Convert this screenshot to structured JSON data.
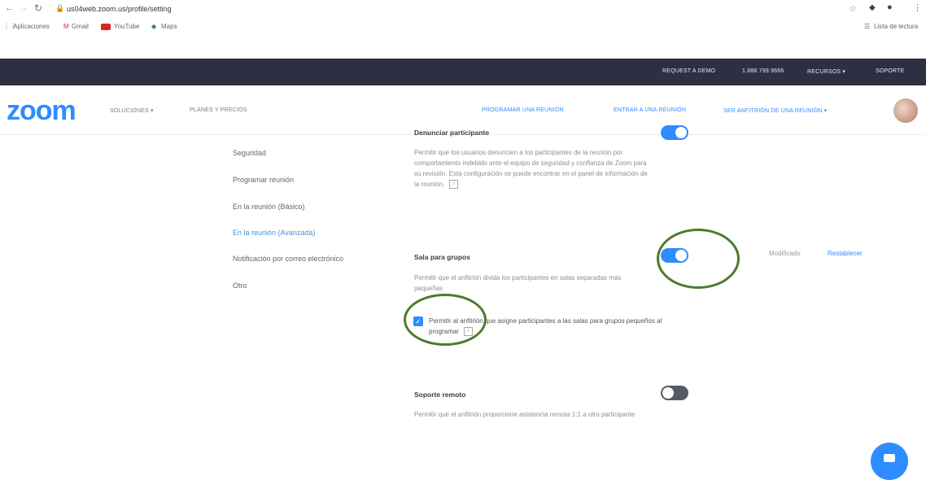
{
  "browser": {
    "url": "us04web.zoom.us/profile/setting",
    "bookmarks": [
      "Aplicaciones",
      "Gmail",
      "YouTube",
      "Maps"
    ],
    "reading_list": "Lista de lectura"
  },
  "topbar": {
    "items": [
      "REQUEST A DEMO",
      "1.888.799.9666",
      "RECURSOS ▾",
      "SOPORTE"
    ]
  },
  "header": {
    "logo": "zoom",
    "left_links": [
      "SOLUCIONES ▾",
      "PLANES Y PRECIOS"
    ],
    "right_links": [
      "PROGRAMAR UNA REUNIÓN",
      "ENTRAR A UNA REUNIÓN",
      "SER ANFITRIÓN DE UNA REUNIÓN ▾"
    ]
  },
  "nav": {
    "items": [
      "Seguridad",
      "Programar reunión",
      "En la reunión (Básico)",
      "En la reunión (Avanzada)",
      "Notificación por correo electrónico",
      "Otro"
    ],
    "active_index": 3
  },
  "settings": {
    "report": {
      "title": "Denunciar participante",
      "description": "Permitir que los usuarios denuncien a los participantes de la reunión por comportamiento indebido ante el equipo de seguridad y confianza de Zoom para su revisión. Esta configuración se puede encontrar en el panel de información de la reunión."
    },
    "breakout": {
      "title": "Sala para grupos",
      "description": "Permitir que el anfitrión divida los participantes en salas separadas más pequeñas",
      "checkbox_label": "Permitir al anfitrión que asigne participantes a las salas para grupos pequeños al programar",
      "modified": "Modificado",
      "reset": "Restablecer",
      "enabled": true
    },
    "remote": {
      "title": "Soporte remoto",
      "description": "Permitir que el anfitrión proporcione asistencia remota 1:1 a otro participante",
      "enabled": false
    }
  },
  "colors": {
    "accent": "#2D8CFF",
    "topbar": "#2d2f42",
    "annotation": "#4e7a2c"
  }
}
